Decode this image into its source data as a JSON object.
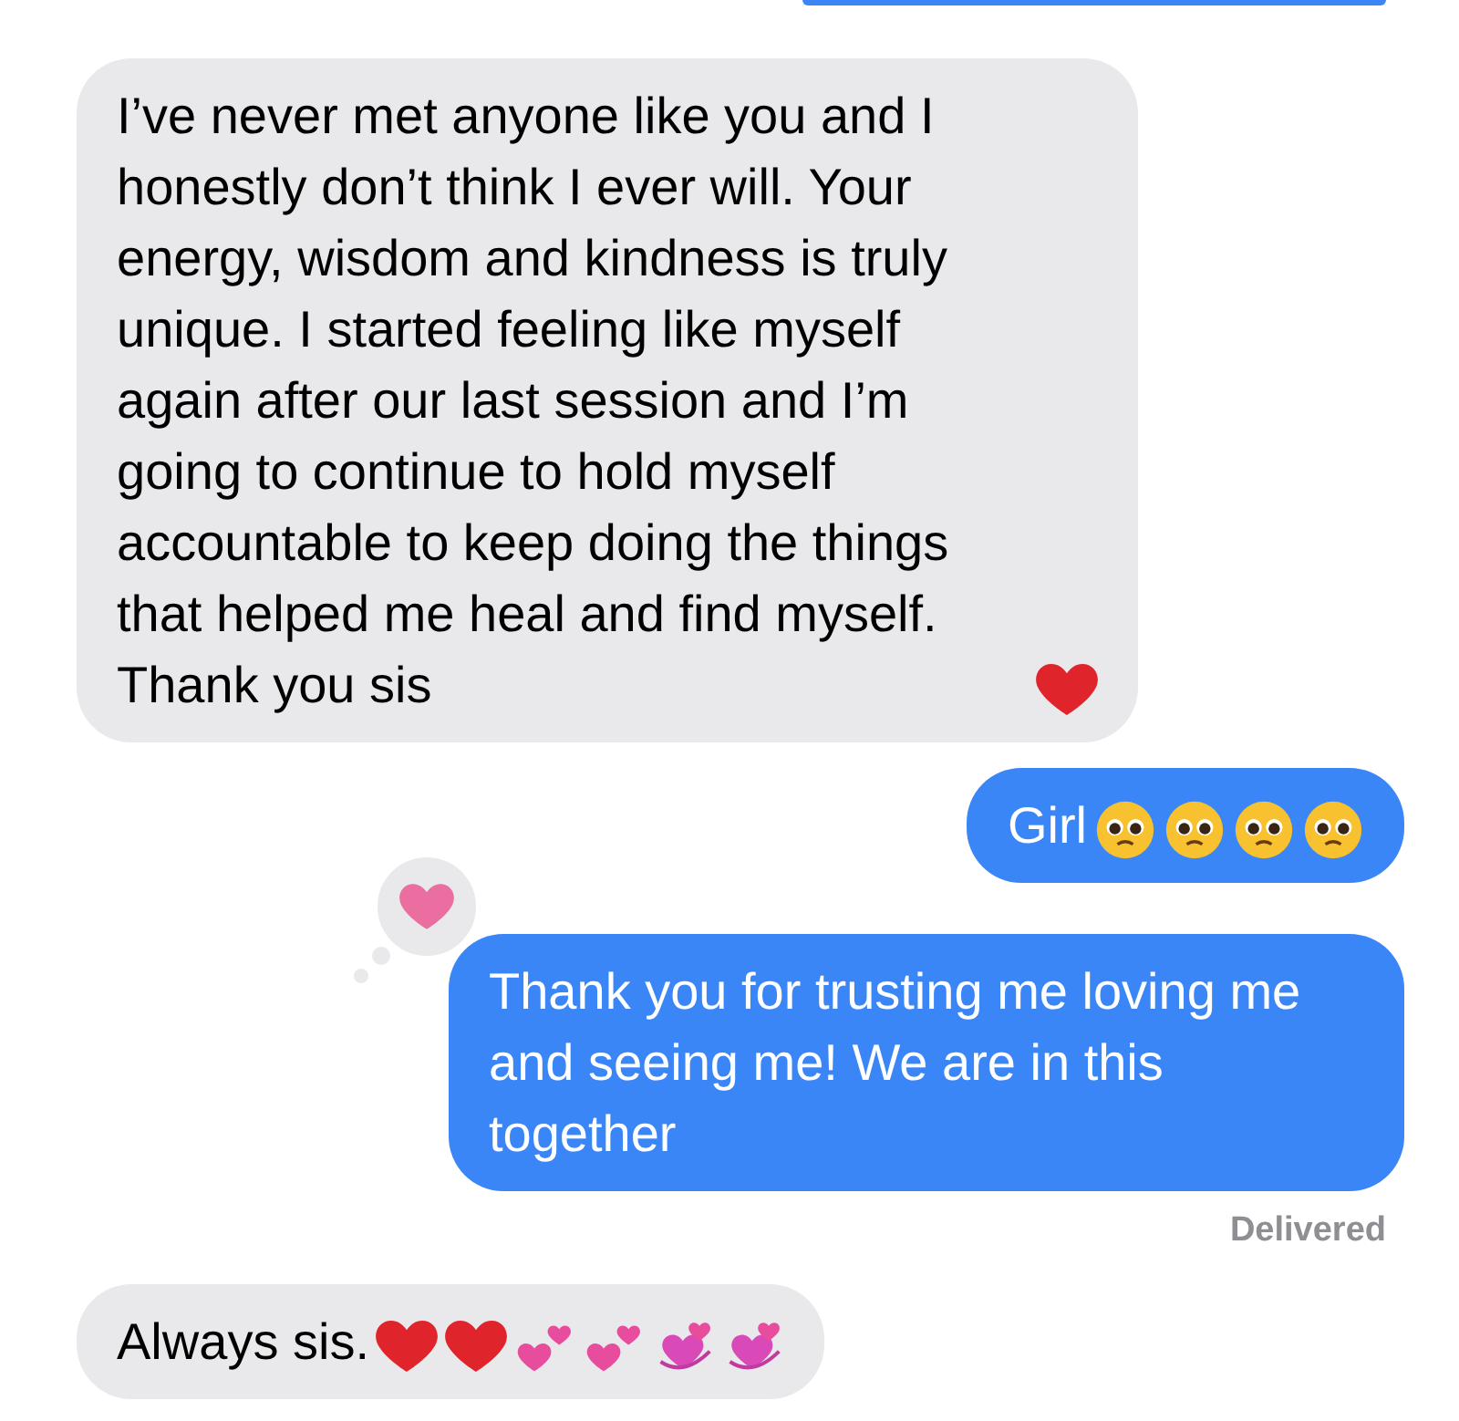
{
  "messages": [
    {
      "kind": "clipped"
    },
    {
      "kind": "incoming",
      "text": "I’ve never met anyone like you and I honestly don’t think I ever will. Your energy, wisdom and kindness is truly unique. I started feeling like myself again after our last session and I’m going to continue to hold myself accountable to keep doing the things that helped me heal and find myself. Thank you sis",
      "emojis": [
        {
          "kind": "red_heart"
        }
      ]
    },
    {
      "kind": "outgoing",
      "text": "Girl",
      "emojis": [
        {
          "kind": "pleading_face"
        },
        {
          "kind": "pleading_face"
        },
        {
          "kind": "pleading_face"
        },
        {
          "kind": "pleading_face"
        }
      ]
    },
    {
      "kind": "outgoing",
      "text": "Thank you for trusting me loving me and seeing me! We are in this together",
      "tapback": {
        "kind": "heart"
      },
      "receipt": "Delivered"
    },
    {
      "kind": "incoming",
      "text": "Always sis.",
      "emojis": [
        {
          "kind": "red_heart"
        },
        {
          "kind": "red_heart"
        },
        {
          "kind": "two_hearts"
        },
        {
          "kind": "two_hearts"
        },
        {
          "kind": "revolving_hearts"
        },
        {
          "kind": "revolving_hearts"
        }
      ]
    }
  ]
}
